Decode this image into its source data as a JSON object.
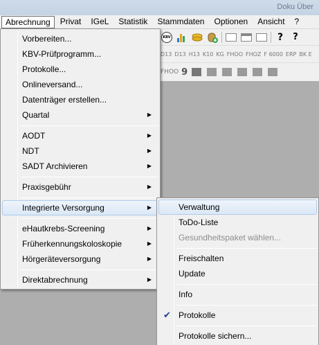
{
  "window": {
    "title": "Doku Über"
  },
  "menubar": {
    "items": [
      "Abrechnung",
      "Privat",
      "IGeL",
      "Statistik",
      "Stammdaten",
      "Optionen",
      "Ansicht",
      "?"
    ]
  },
  "toolbar": {
    "row2": [
      "D13",
      "D13",
      "H13",
      "K10",
      "KG",
      "FHOO",
      "FHOZ",
      "F",
      "ERP",
      "BK"
    ],
    "row2_sub": [
      "6000",
      "E"
    ],
    "row3": [
      "FHOO",
      "9"
    ]
  },
  "abrechnung_menu": {
    "group1": [
      "Vorbereiten...",
      "KBV-Prüfprogramm...",
      "Protokolle...",
      "Onlineversand...",
      "Datenträger erstellen...",
      "Quartal"
    ],
    "group2": [
      "AODT",
      "NDT",
      "SADT Archivieren"
    ],
    "group3": [
      "Praxisgebühr"
    ],
    "group4": [
      "Integrierte Versorgung"
    ],
    "group5": [
      "eHautkrebs-Screening",
      "Früherkennungskoloskopie",
      "Hörgeräteversorgung"
    ],
    "group6": [
      "Direktabrechnung"
    ]
  },
  "iv_submenu": {
    "items": [
      "Verwaltung",
      "ToDo-Liste",
      "Gesundheitspaket wählen...",
      "Freischalten",
      "Update",
      "Info",
      "Protokolle",
      "Protokolle sichern..."
    ]
  },
  "colors": {
    "menu_bg": "#f0f0f0",
    "highlight": "#dbe8f6",
    "highlight_border": "#aecbec",
    "workspace": "#aeaeae",
    "checkmark": "#1d3b8a"
  }
}
